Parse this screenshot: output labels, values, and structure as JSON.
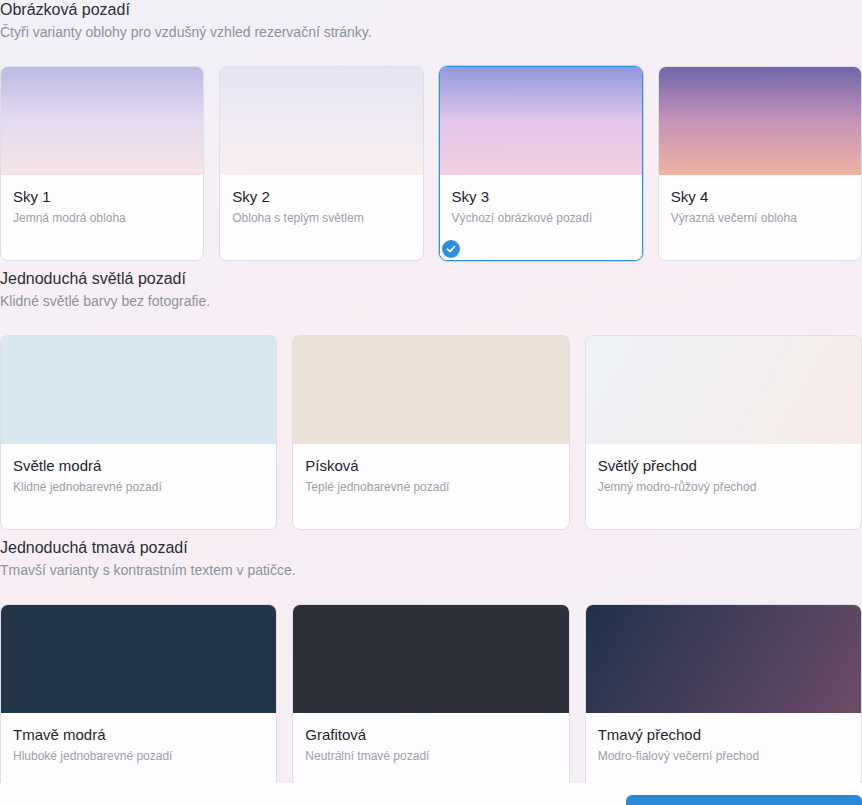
{
  "sections": [
    {
      "title": "Obrázková pozadí",
      "subtitle": "Čtyři varianty oblohy pro vzdušný vzhled rezervační stránky.",
      "cards": [
        {
          "name": "Sky 1",
          "description": "Jemná modrá obloha",
          "selected": false,
          "kind": "photo",
          "colors": [
            "#bcbbe4",
            "#e6dbef",
            "#f6e5e8"
          ]
        },
        {
          "name": "Sky 2",
          "description": "Obloha s teplým světlem",
          "selected": false,
          "kind": "photo",
          "colors": [
            "#e6e5f2",
            "#efebf3",
            "#f8eeee"
          ]
        },
        {
          "name": "Sky 3",
          "description": "Výchozí obrázkové pozadí",
          "selected": true,
          "kind": "photo",
          "colors": [
            "#9198dd",
            "#e3c6ea",
            "#f1d0df"
          ]
        },
        {
          "name": "Sky 4",
          "description": "Výrazná večerní obloha",
          "selected": false,
          "kind": "photo",
          "colors": [
            "#6f66aa",
            "#c593b9",
            "#eeb3a2"
          ]
        }
      ]
    },
    {
      "title": "Jednoduchá světlá pozadí",
      "subtitle": "Klidné světlé barvy bez fotografie.",
      "cards": [
        {
          "name": "Světle modrá",
          "description": "Klidné jednobarevné pozadí",
          "selected": false,
          "kind": "solid",
          "colors": [
            "#d9e8f0"
          ]
        },
        {
          "name": "Písková",
          "description": "Teplé jednobarevné pozadí",
          "selected": false,
          "kind": "solid",
          "colors": [
            "#ede2d8"
          ]
        },
        {
          "name": "Světlý přechod",
          "description": "Jemný modro-růžový přechod",
          "selected": false,
          "kind": "gradient",
          "colors": [
            "#eef2f7",
            "#f6ebe8"
          ]
        }
      ]
    },
    {
      "title": "Jednoduchá tmavá pozadí",
      "subtitle": "Tmavší varianty s kontrastním textem v patičce.",
      "cards": [
        {
          "name": "Tmavě modrá",
          "description": "Hluboké jednobarevné pozadí",
          "selected": false,
          "kind": "solid",
          "colors": [
            "#233547"
          ]
        },
        {
          "name": "Grafitová",
          "description": "Neutrální tmavé pozadí",
          "selected": false,
          "kind": "solid",
          "colors": [
            "#2e3139"
          ]
        },
        {
          "name": "Tmavý přechod",
          "description": "Modro-fialový večerní přechod",
          "selected": false,
          "kind": "gradient",
          "colors": [
            "#20314a",
            "#6c4c66"
          ]
        }
      ]
    }
  ]
}
